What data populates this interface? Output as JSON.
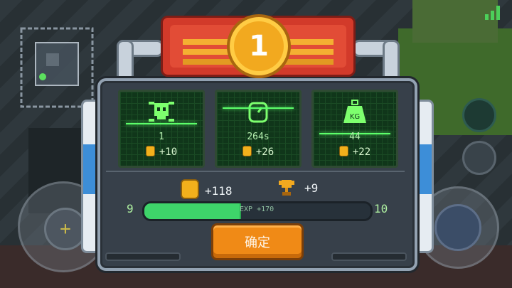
{
  "banner": {
    "rank": "1"
  },
  "stats": [
    {
      "icon": "skull-icon",
      "value": "1",
      "reward": "+10"
    },
    {
      "icon": "clock-icon",
      "value": "264s",
      "reward": "+26"
    },
    {
      "icon": "weight-icon",
      "icon_label": "KG",
      "value": "44",
      "reward": "+22"
    }
  ],
  "totals": {
    "coins": "+118",
    "trophies": "+9"
  },
  "level": {
    "current": "9",
    "next": "10",
    "exp_text": "EXP +170",
    "progress": 0.42
  },
  "confirm_label": "确定",
  "colors": {
    "accent": "#f08a16",
    "card_bg": "#10361a",
    "exp_bar": "#3ed46a",
    "banner": "#d23a2a"
  }
}
